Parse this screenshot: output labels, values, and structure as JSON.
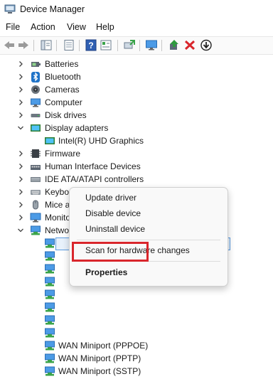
{
  "window": {
    "title": "Device Manager",
    "icon": "device-manager-icon"
  },
  "menubar": [
    "File",
    "Action",
    "View",
    "Help"
  ],
  "toolbar": [
    "back-arrow-icon",
    "forward-arrow-icon",
    "show-hide-tree-icon",
    "properties-icon",
    "help-icon",
    "view-icon",
    "update-driver-icon",
    "monitor-icon",
    "enable-device-icon",
    "uninstall-x-icon",
    "download-arrow-icon"
  ],
  "tree": [
    {
      "label": "Batteries",
      "icon": "battery-icon",
      "expanded": false
    },
    {
      "label": "Bluetooth",
      "icon": "bluetooth-icon",
      "expanded": false
    },
    {
      "label": "Cameras",
      "icon": "camera-icon",
      "expanded": false
    },
    {
      "label": "Computer",
      "icon": "computer-icon",
      "expanded": false
    },
    {
      "label": "Disk drives",
      "icon": "disk-drive-icon",
      "expanded": false
    },
    {
      "label": "Display adapters",
      "icon": "display-adapter-icon",
      "expanded": true
    },
    {
      "label": "Intel(R) UHD Graphics",
      "icon": "display-adapter-icon",
      "child": true
    },
    {
      "label": "Firmware",
      "icon": "firmware-icon",
      "expanded": false
    },
    {
      "label": "Human Interface Devices",
      "icon": "hid-icon",
      "expanded": false
    },
    {
      "label": "IDE ATA/ATAPI controllers",
      "icon": "ide-controller-icon",
      "expanded": false
    },
    {
      "label": "Keyboards",
      "icon": "keyboard-icon",
      "expanded": false
    },
    {
      "label": "Mice and other pointing devices",
      "icon": "mouse-icon",
      "expanded": false
    },
    {
      "label": "Monitors",
      "icon": "monitor-icon",
      "expanded": false
    },
    {
      "label": "Network adapters",
      "icon": "network-adapter-icon",
      "expanded": true
    }
  ],
  "network_children": [
    {
      "label": "",
      "icon": "network-adapter-icon"
    },
    {
      "label": "",
      "icon": "network-adapter-icon"
    },
    {
      "label": "",
      "icon": "network-adapter-icon"
    },
    {
      "label": "",
      "icon": "network-adapter-icon"
    },
    {
      "label": "",
      "icon": "network-adapter-icon"
    },
    {
      "label": "",
      "icon": "network-adapter-icon"
    },
    {
      "label": "",
      "icon": "network-adapter-icon"
    },
    {
      "label": "",
      "icon": "network-adapter-icon"
    },
    {
      "label": "WAN Miniport (PPPOE)",
      "icon": "network-adapter-icon"
    },
    {
      "label": "WAN Miniport (PPTP)",
      "icon": "network-adapter-icon"
    },
    {
      "label": "WAN Miniport (SSTP)",
      "icon": "network-adapter-icon"
    }
  ],
  "context_menu": {
    "items": [
      {
        "label": "Update driver",
        "bold": false
      },
      {
        "label": "Disable device",
        "bold": false
      },
      {
        "label": "Uninstall device",
        "bold": false
      },
      {
        "label": "Scan for hardware changes",
        "bold": false
      },
      {
        "label": "Properties",
        "bold": true
      }
    ],
    "highlighted": "Update driver"
  },
  "colors": {
    "highlight": "#d9262c",
    "selection_border": "#5b9be0",
    "selection_fill": "#e8f1fb",
    "network_green": "#3aa34a",
    "monitor_blue": "#2f7fd6"
  }
}
